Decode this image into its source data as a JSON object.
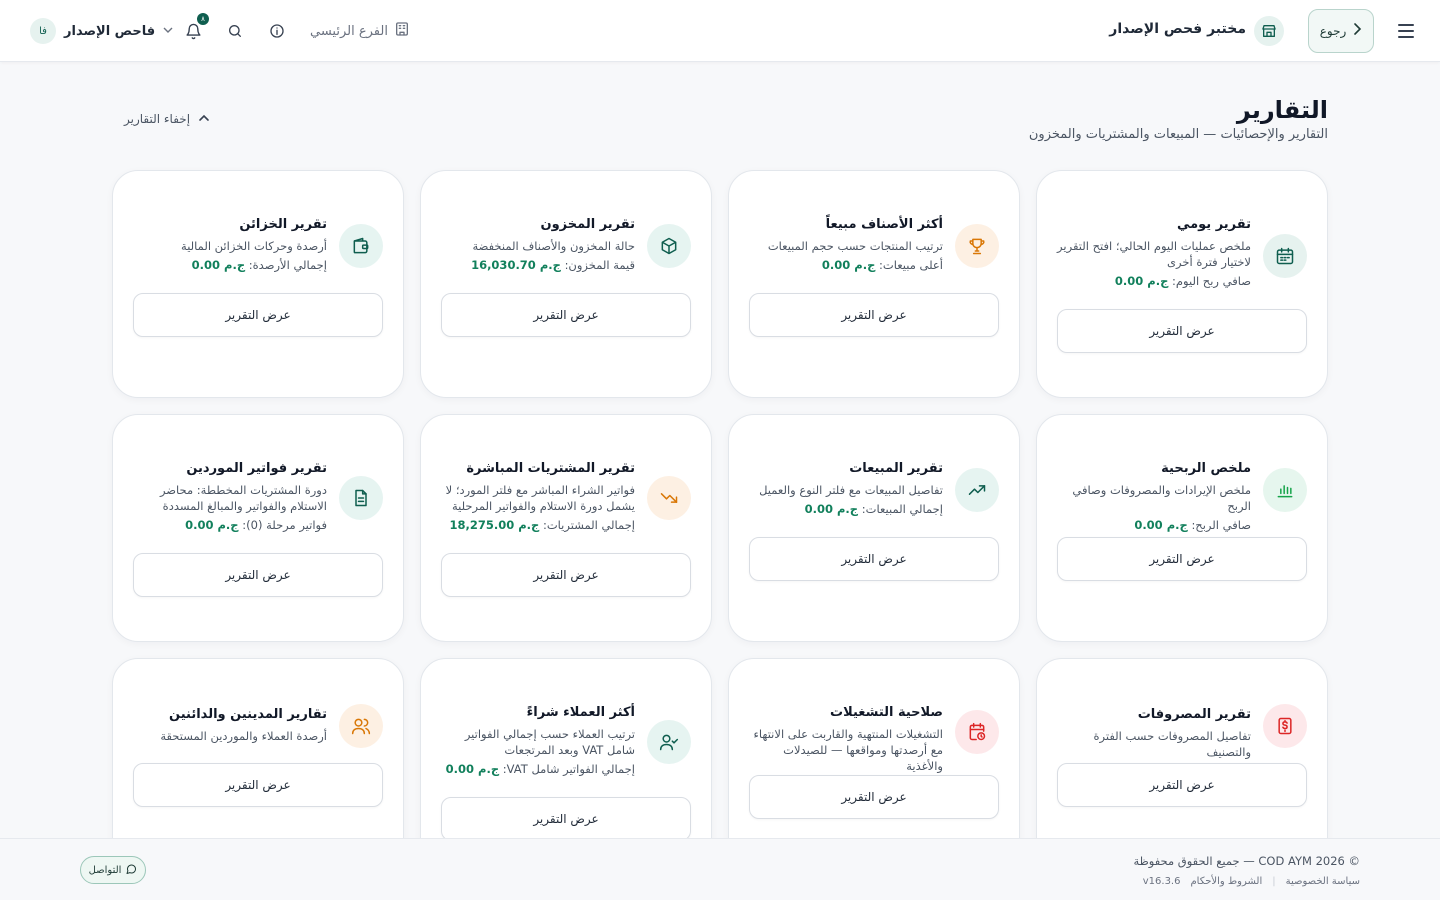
{
  "colors": {
    "brand": "#0f5e4f",
    "money": "#12805c",
    "green_bg": "#e6f2ef",
    "orange_bg": "#fdf0e3",
    "red_bg": "#fde8ea",
    "teal_bg": "#e6f4f1"
  },
  "header": {
    "back_label": "رجوع",
    "lab_name": "مختبر فحص الإصدار",
    "branch_label": "الفرع الرئيسي",
    "notifications_count": "٨",
    "user": {
      "initials": "فا",
      "name": "فاحص الإصدار"
    }
  },
  "page": {
    "title": "التقارير",
    "subtitle": "التقارير والإحصائيات — المبيعات والمشتريات والمخزون",
    "hide_label": "إخفاء التقارير"
  },
  "view_report_label": "عرض التقرير",
  "cards": [
    {
      "icon": "calendar-icon",
      "title": "تقرير يومي",
      "desc": "ملخص عمليات اليوم الحالي؛ افتح التقرير لاختيار فترة أخرى",
      "metric_label": "صافي ربح اليوم:",
      "metric_value": "ج.م 0.00"
    },
    {
      "icon": "trophy-icon",
      "title": "أكثر الأصناف مبيعاً",
      "desc": "ترتيب المنتجات حسب حجم المبيعات",
      "metric_label": "أعلى مبيعات:",
      "metric_value": "ج.م 0.00"
    },
    {
      "icon": "box-icon",
      "title": "تقرير المخزون",
      "desc": "حالة المخزون والأصناف المنخفضة",
      "metric_label": "قيمة المخزون:",
      "metric_value": "ج.م 16,030.70"
    },
    {
      "icon": "wallet-icon",
      "title": "تقرير الخزائن",
      "desc": "أرصدة وحركات الخزائن المالية",
      "metric_label": "إجمالي الأرصدة:",
      "metric_value": "ج.م 0.00"
    },
    {
      "icon": "bar-chart-icon",
      "title": "ملخص الربحية",
      "desc": "ملخص الإيرادات والمصروفات وصافي الربح",
      "metric_label": "صافي الربح:",
      "metric_value": "ج.م 0.00"
    },
    {
      "icon": "trending-up-icon",
      "title": "تقرير المبيعات",
      "desc": "تفاصيل المبيعات مع فلتر النوع والعميل",
      "metric_label": "إجمالي المبيعات:",
      "metric_value": "ج.م 0.00"
    },
    {
      "icon": "trending-down-icon",
      "title": "تقرير المشتريات المباشرة",
      "desc": "فواتير الشراء المباشر مع فلتر المورد؛ لا يشمل دورة الاستلام والفواتير المرحلية",
      "metric_label": "إجمالي المشتريات:",
      "metric_value": "ج.م 18,275.00"
    },
    {
      "icon": "document-icon",
      "title": "تقرير فواتير الموردين",
      "desc": "دورة المشتريات المخططة: محاضر الاستلام والفواتير والمبالغ المسددة",
      "metric_label": "فواتير مرحلة (0):",
      "metric_value": "ج.م 0.00"
    },
    {
      "icon": "money-icon",
      "title": "تقرير المصروفات",
      "desc": "تفاصيل المصروفات حسب الفترة والتصنيف",
      "metric_label": "",
      "metric_value": ""
    },
    {
      "icon": "expiry-calendar-icon",
      "title": "صلاحية التشغيلات",
      "desc": "التشغيلات المنتهية والقاربت على الانتهاء مع أرصدتها ومواقعها — للصيدلات والأغذية",
      "metric_label": "",
      "metric_value": ""
    },
    {
      "icon": "user-check-icon",
      "title": "أكثر العملاء شراءً",
      "desc": "ترتيب العملاء حسب إجمالي الفواتير شامل VAT وبعد المرتجعات",
      "metric_label": "إجمالي الفواتير شامل VAT:",
      "metric_value": "ج.م 0.00"
    },
    {
      "icon": "users-icon",
      "title": "تقارير المدينين والدائنين",
      "desc": "أرصدة العملاء والموردين المستحقة",
      "metric_label": "",
      "metric_value": ""
    }
  ],
  "footer": {
    "copyright": "© COD AYM 2026 — جميع الحقوق محفوظة",
    "privacy": "سياسة الخصوصية",
    "terms": "الشروط والأحكام",
    "version": "v16.3.6",
    "contact": "التواصل"
  }
}
